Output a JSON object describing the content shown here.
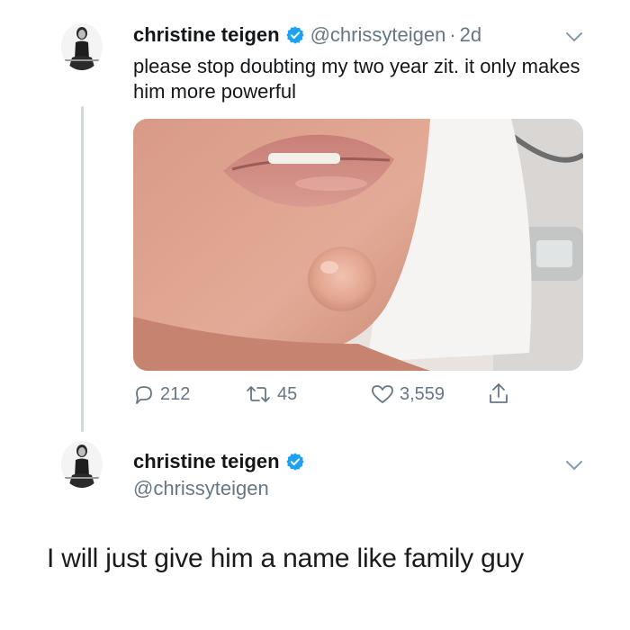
{
  "tweet": {
    "display_name": "christine teigen",
    "handle": "@chrissyteigen",
    "separator": "·",
    "time": "2d",
    "text": "please stop doubting my two year zit. it only makes him more powerful",
    "actions": {
      "replies": "212",
      "retweets": "45",
      "likes": "3,559"
    },
    "icons": {
      "verified": "verified-badge-icon",
      "menu": "chevron-down-icon",
      "reply": "reply-icon",
      "retweet": "retweet-icon",
      "like": "heart-icon",
      "share": "share-icon"
    }
  },
  "reply": {
    "display_name": "christine teigen",
    "handle": "@chrissyteigen"
  },
  "caption": "I will just give him a name like family guy",
  "colors": {
    "verified": "#1da1f2",
    "secondary_text": "#657786",
    "thread_line": "#cfd9de"
  }
}
